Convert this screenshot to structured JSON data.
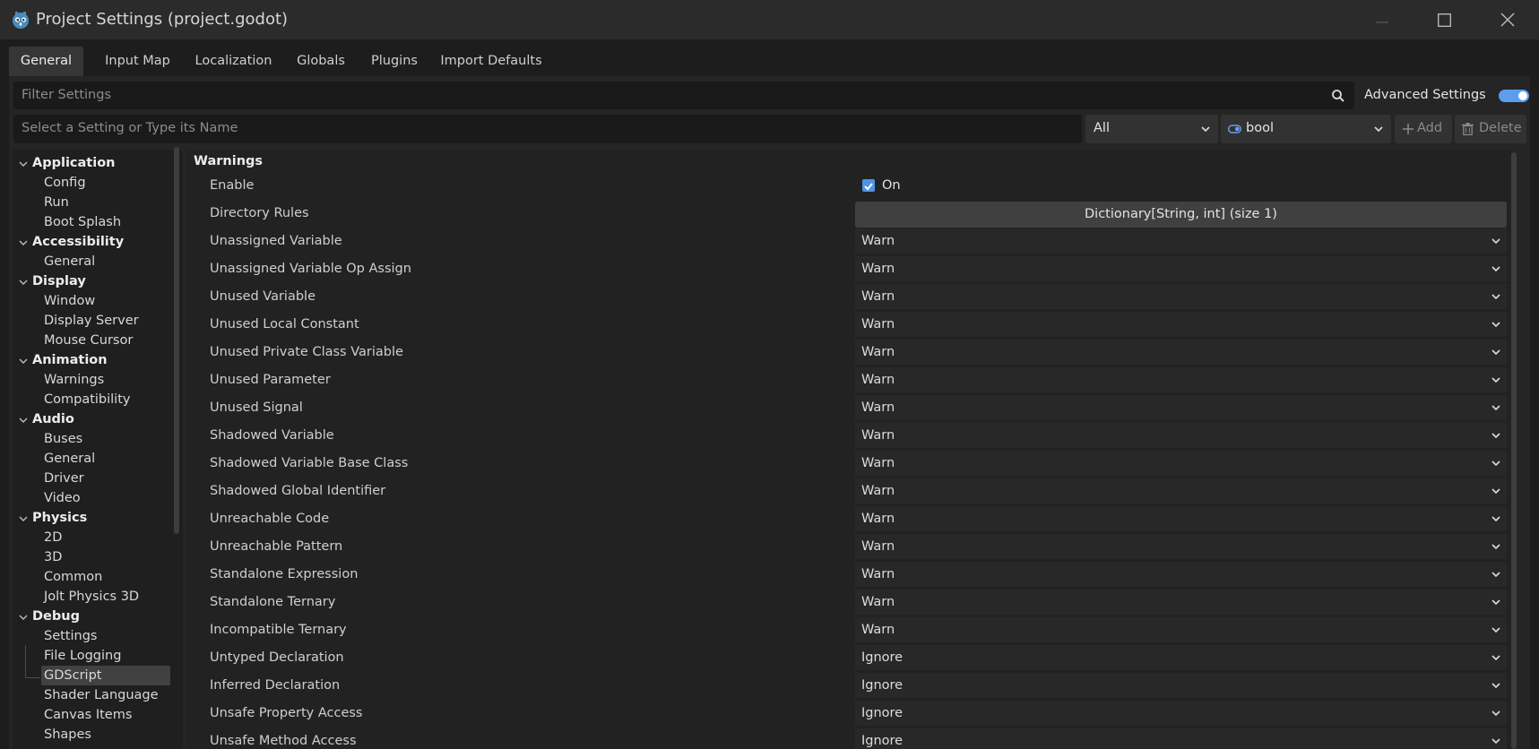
{
  "window": {
    "title": "Project Settings (project.godot)"
  },
  "tabs": [
    "General",
    "Input Map",
    "Localization",
    "Globals",
    "Plugins",
    "Import Defaults"
  ],
  "active_tab": "General",
  "filter": {
    "placeholder": "Filter Settings"
  },
  "advanced": {
    "label": "Advanced Settings",
    "enabled": true
  },
  "add_setting": {
    "placeholder": "Select a Setting or Type its Name",
    "category_value": "All",
    "type_value": "bool",
    "add_label": "Add",
    "delete_label": "Delete"
  },
  "tree": [
    {
      "label": "Application",
      "kind": "category"
    },
    {
      "label": "Config",
      "kind": "item"
    },
    {
      "label": "Run",
      "kind": "item"
    },
    {
      "label": "Boot Splash",
      "kind": "item"
    },
    {
      "label": "Accessibility",
      "kind": "category"
    },
    {
      "label": "General",
      "kind": "item"
    },
    {
      "label": "Display",
      "kind": "category"
    },
    {
      "label": "Window",
      "kind": "item"
    },
    {
      "label": "Display Server",
      "kind": "item"
    },
    {
      "label": "Mouse Cursor",
      "kind": "item"
    },
    {
      "label": "Animation",
      "kind": "category"
    },
    {
      "label": "Warnings",
      "kind": "item"
    },
    {
      "label": "Compatibility",
      "kind": "item"
    },
    {
      "label": "Audio",
      "kind": "category"
    },
    {
      "label": "Buses",
      "kind": "item"
    },
    {
      "label": "General",
      "kind": "item"
    },
    {
      "label": "Driver",
      "kind": "item"
    },
    {
      "label": "Video",
      "kind": "item"
    },
    {
      "label": "Physics",
      "kind": "category"
    },
    {
      "label": "2D",
      "kind": "item"
    },
    {
      "label": "3D",
      "kind": "item"
    },
    {
      "label": "Common",
      "kind": "item"
    },
    {
      "label": "Jolt Physics 3D",
      "kind": "item"
    },
    {
      "label": "Debug",
      "kind": "category"
    },
    {
      "label": "Settings",
      "kind": "item"
    },
    {
      "label": "File Logging",
      "kind": "item"
    },
    {
      "label": "GDScript",
      "kind": "item",
      "selected": true
    },
    {
      "label": "Shader Language",
      "kind": "item"
    },
    {
      "label": "Canvas Items",
      "kind": "item"
    },
    {
      "label": "Shapes",
      "kind": "item"
    }
  ],
  "section": {
    "title": "Warnings",
    "enable": {
      "label": "Enable",
      "value": "On",
      "checked": true
    },
    "directory_rules": {
      "label": "Directory Rules",
      "value": "Dictionary[String, int] (size 1)"
    },
    "rows": [
      {
        "label": "Unassigned Variable",
        "value": "Warn"
      },
      {
        "label": "Unassigned Variable Op Assign",
        "value": "Warn"
      },
      {
        "label": "Unused Variable",
        "value": "Warn"
      },
      {
        "label": "Unused Local Constant",
        "value": "Warn"
      },
      {
        "label": "Unused Private Class Variable",
        "value": "Warn"
      },
      {
        "label": "Unused Parameter",
        "value": "Warn"
      },
      {
        "label": "Unused Signal",
        "value": "Warn"
      },
      {
        "label": "Shadowed Variable",
        "value": "Warn"
      },
      {
        "label": "Shadowed Variable Base Class",
        "value": "Warn"
      },
      {
        "label": "Shadowed Global Identifier",
        "value": "Warn"
      },
      {
        "label": "Unreachable Code",
        "value": "Warn"
      },
      {
        "label": "Unreachable Pattern",
        "value": "Warn"
      },
      {
        "label": "Standalone Expression",
        "value": "Warn"
      },
      {
        "label": "Standalone Ternary",
        "value": "Warn"
      },
      {
        "label": "Incompatible Ternary",
        "value": "Warn"
      },
      {
        "label": "Untyped Declaration",
        "value": "Ignore"
      },
      {
        "label": "Inferred Declaration",
        "value": "Ignore"
      },
      {
        "label": "Unsafe Property Access",
        "value": "Ignore"
      },
      {
        "label": "Unsafe Method Access",
        "value": "Ignore"
      }
    ]
  },
  "colors": {
    "accent": "#5b9ef0",
    "bg": "#1d1d1d",
    "panel": "#252525"
  },
  "icons": {
    "app": "godot-icon",
    "search": "search-icon",
    "add": "plus-icon",
    "delete": "trash-icon",
    "type": "bool-type-icon"
  }
}
